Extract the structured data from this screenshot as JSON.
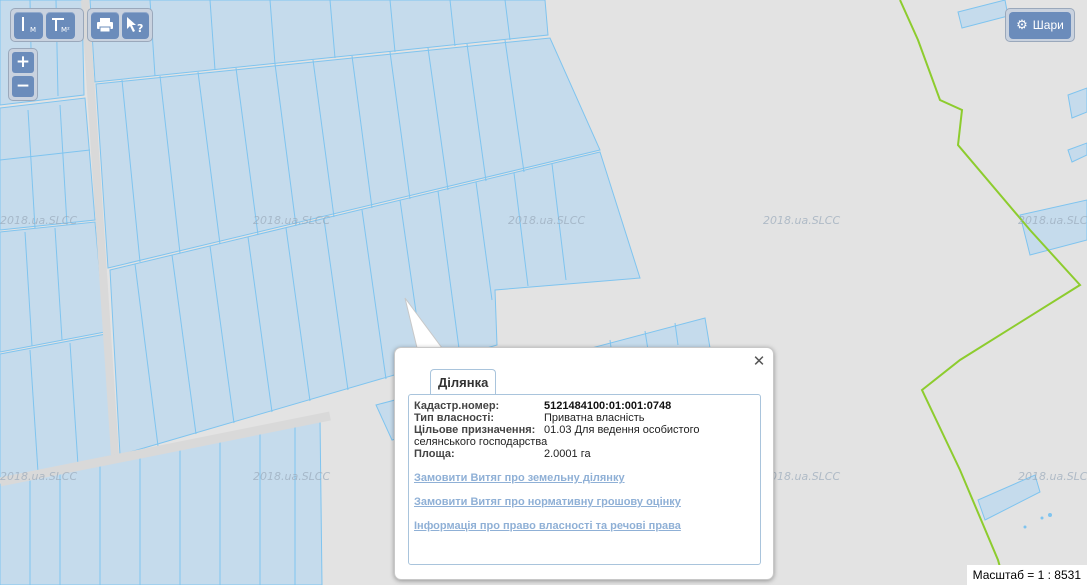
{
  "toolbar": {
    "measure_line_unit": "М",
    "measure_area_unit": "М²",
    "zoom_in": "+",
    "zoom_out": "−",
    "print_icon": "printer-icon",
    "identify_icon": "pointer-question-icon"
  },
  "layers": {
    "label": "Шари",
    "icon": "gear-icon"
  },
  "watermark": "2018.ua.SLCC",
  "popup": {
    "tab_label": "Ділянка",
    "rows": [
      {
        "label": "Кадастр.номер:",
        "value": "5121484100:01:001:0748"
      },
      {
        "label": "Тип власності:",
        "value": "Приватна власність"
      },
      {
        "label": "Цільове призначення:",
        "value": "01.03 Для ведення особистого селянського господарства"
      },
      {
        "label": "Площа:",
        "value": "2.0001 га"
      }
    ],
    "links": [
      "Замовити Витяг про земельну ділянку",
      "Замовити Витяг про нормативну грошову оцінку",
      "Інформація про право власності та речові права"
    ],
    "close_label": "✕"
  },
  "scale": "Масштаб = 1 : 8531",
  "colors": {
    "parcel_fill": "#c5dbec",
    "parcel_stroke": "#7fc4ef",
    "boundary": "#8dcc2e",
    "road": "#e0e0e0",
    "button": "#6b8cbb",
    "link": "#8fb0d6"
  }
}
